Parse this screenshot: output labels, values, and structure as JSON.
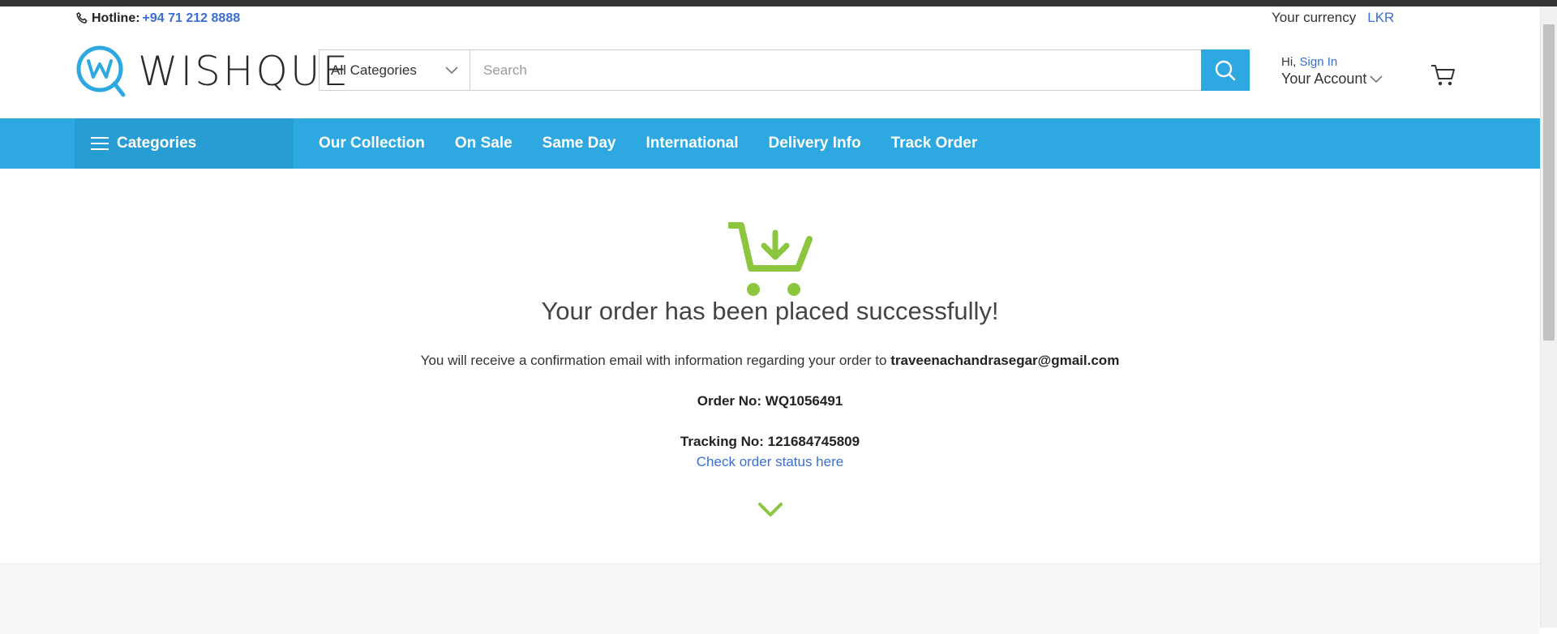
{
  "topbar": {
    "hotline_label": "Hotline:",
    "hotline_number": "+94 71 212 8888",
    "currency_label": "Your currency",
    "currency_code": "LKR"
  },
  "header": {
    "logo_text": "WISHQUE",
    "category_select": "All Categories",
    "search_placeholder": "Search",
    "account_hi": "Hi,",
    "account_signin": "Sign In",
    "account_label": "Your Account"
  },
  "nav": {
    "categories_label": "Categories",
    "links": [
      "Our Collection",
      "On Sale",
      "Same Day",
      "International",
      "Delivery Info",
      "Track Order"
    ]
  },
  "order": {
    "title": "Your order has been placed successfully!",
    "confirm_text": "You will receive a confirmation email with information regarding your order to",
    "email": "traveenachandrasegar@gmail.com",
    "order_no": "Order No: WQ1056491",
    "tracking_no": "Tracking No: 121684745809",
    "check_status": "Check order status here"
  },
  "colors": {
    "accent": "#2ea8e0",
    "success_green": "#8cc63f",
    "link": "#3a6fd1"
  }
}
